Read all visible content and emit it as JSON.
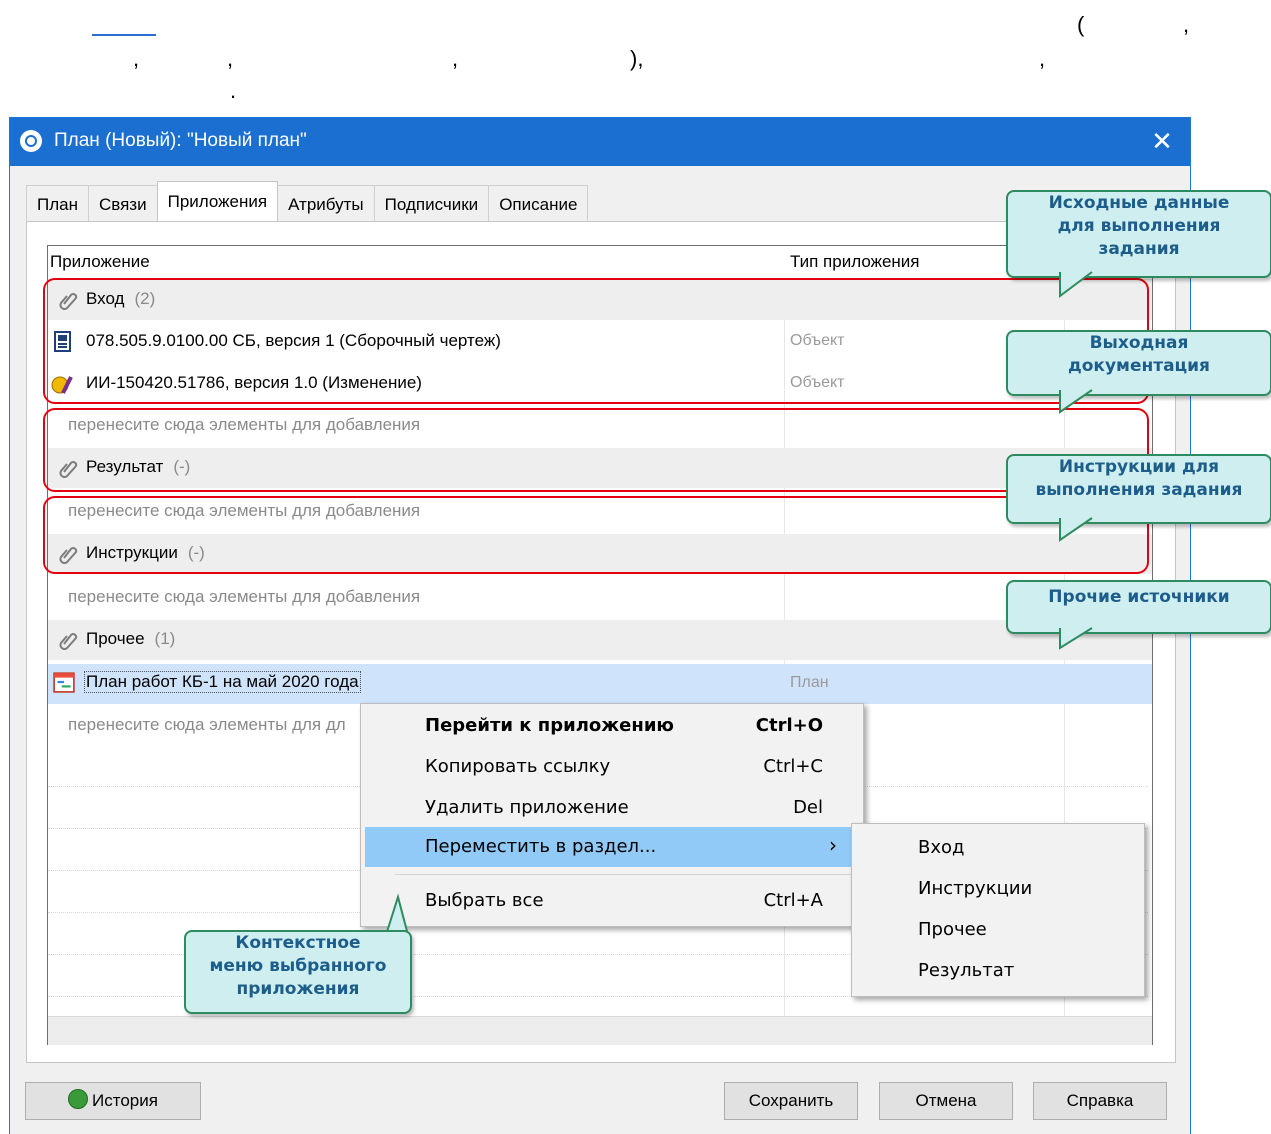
{
  "doc": {
    "punct_items": [
      "(",
      ",",
      ",",
      ",",
      ",",
      "),",
      ",",
      "."
    ]
  },
  "window": {
    "title": "План (Новый): \"Новый план\"",
    "close_glyph": "✕"
  },
  "tabs": [
    {
      "label": "План"
    },
    {
      "label": "Связи"
    },
    {
      "label": "Приложения"
    },
    {
      "label": "Атрибуты"
    },
    {
      "label": "Подписчики"
    },
    {
      "label": "Описание"
    }
  ],
  "grid": {
    "col_app": "Приложение",
    "col_type": "Тип приложения",
    "drop_hint": "перенесите сюда элементы для добавления",
    "groups": {
      "input": {
        "name": "Вход",
        "count": "(2)"
      },
      "result": {
        "name": "Результат",
        "count": "(-)"
      },
      "instr": {
        "name": "Инструкции",
        "count": "(-)"
      },
      "other": {
        "name": "Прочее",
        "count": "(1)"
      }
    },
    "items": {
      "item1": {
        "name": "078.505.9.0100.00 СБ, версия 1 (Сборочный чертеж)",
        "type": "Объект"
      },
      "item2": {
        "name": "ИИ-150420.51786, версия 1.0 (Изменение)",
        "type": "Объект"
      },
      "item3": {
        "name": "План работ КБ-1 на май 2020 года",
        "type": "План"
      }
    },
    "drop_hint_truncated": "перенесите сюда элементы для дл"
  },
  "callouts": {
    "input": "Исходные данные\nдля выполнения\nзадания",
    "output": "Выходная\nдокументация",
    "instr": "Инструкции для\nвыполнения задания",
    "other": "Прочие источники",
    "menu": "Контекстное\nменю выбранного\nприложения"
  },
  "context_menu": {
    "goto": {
      "label": "Перейти к приложению",
      "key": "Ctrl+O"
    },
    "copy": {
      "label": "Копировать ссылку",
      "key": "Ctrl+C"
    },
    "delete": {
      "label": "Удалить приложение",
      "key": "Del"
    },
    "move": {
      "label": "Переместить в раздел...",
      "arrow": "›"
    },
    "selectall": {
      "label": "Выбрать все",
      "key": "Ctrl+A"
    }
  },
  "submenu": [
    "Вход",
    "Инструкции",
    "Прочее",
    "Результат"
  ],
  "buttons": {
    "history": "История",
    "save": "Сохранить",
    "cancel": "Отмена",
    "help": "Справка"
  },
  "colors": {
    "titlebar": "#1b6fd0",
    "highlight": "#91c9f7",
    "selected_row": "#cfe4fb",
    "frame_red": "#e3000f",
    "callout_fill": "#cfeef0",
    "callout_border": "#2e8b5f",
    "callout_text": "#1d5d8a"
  }
}
